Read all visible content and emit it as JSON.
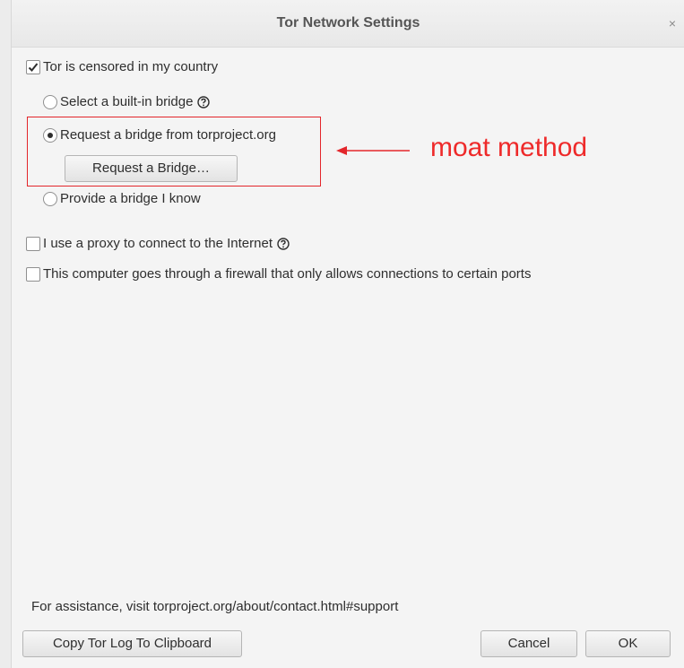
{
  "window": {
    "title": "Tor Network Settings",
    "close_glyph": "×"
  },
  "options": {
    "censored_label": "Tor is censored in my country",
    "censored_checked": true,
    "builtin_bridge_label": "Select a built-in bridge",
    "request_bridge_label": "Request a bridge from torproject.org",
    "request_bridge_selected": true,
    "request_bridge_button": "Request a Bridge…",
    "provide_bridge_label": "Provide a bridge I know",
    "proxy_label": "I use a proxy to connect to the Internet",
    "proxy_checked": false,
    "firewall_label": "This computer goes through a firewall that only allows connections to certain ports",
    "firewall_checked": false
  },
  "annotation": {
    "text": "moat method",
    "color": "#ee2a2a"
  },
  "footer": {
    "assistance_text": "For assistance, visit torproject.org/about/contact.html#support",
    "copy_log_button": "Copy Tor Log To Clipboard",
    "cancel_button": "Cancel",
    "ok_button": "OK"
  },
  "icons": {
    "help": "question-circle-icon",
    "close": "close-icon",
    "arrow": "arrow-left-icon"
  }
}
